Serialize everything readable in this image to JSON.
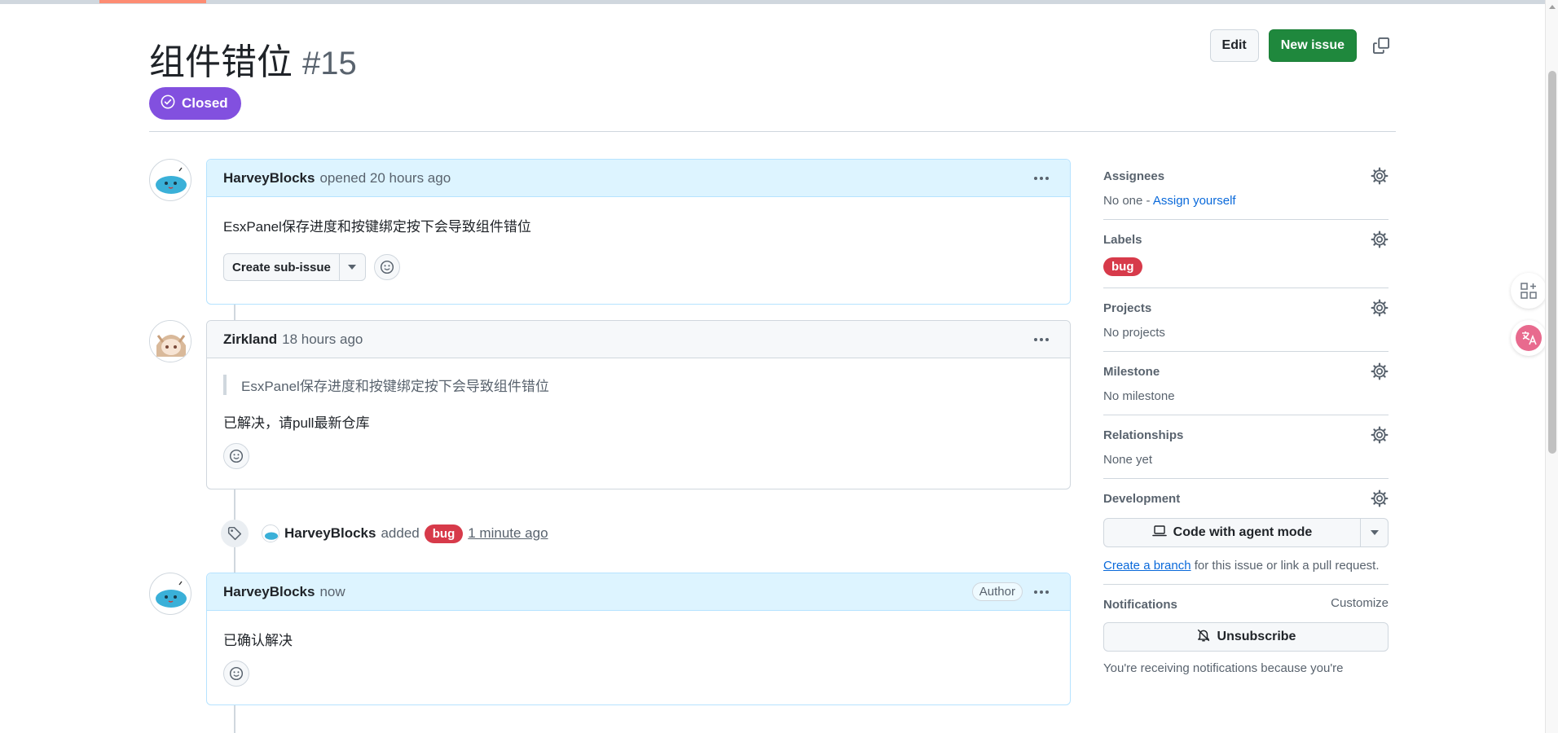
{
  "issue": {
    "title": "组件错位",
    "number": "#15",
    "status": "Closed"
  },
  "header": {
    "edit_label": "Edit",
    "new_issue_label": "New issue",
    "copy_icon": "copy-icon"
  },
  "timeline": {
    "comment1": {
      "user": "HarveyBlocks",
      "meta": "opened 20 hours ago",
      "body": "EsxPanel保存进度和按键绑定按下会导致组件错位",
      "sub_issue_label": "Create sub-issue"
    },
    "comment2": {
      "user": "Zirkland",
      "meta": "18 hours ago",
      "quote": "EsxPanel保存进度和按键绑定按下会导致组件错位",
      "body": "已解决，请pull最新仓库"
    },
    "event": {
      "user": "HarveyBlocks",
      "action": "added",
      "label": "bug",
      "time": "1 minute ago"
    },
    "comment3": {
      "user": "HarveyBlocks",
      "meta": "now",
      "badge": "Author",
      "body": "已确认解决"
    }
  },
  "sidebar": {
    "assignees": {
      "title": "Assignees",
      "value": "No one - ",
      "link": "Assign yourself"
    },
    "labels": {
      "title": "Labels",
      "label": "bug"
    },
    "projects": {
      "title": "Projects",
      "value": "No projects"
    },
    "milestone": {
      "title": "Milestone",
      "value": "No milestone"
    },
    "relationships": {
      "title": "Relationships",
      "value": "None yet"
    },
    "development": {
      "title": "Development",
      "agent_button": "Code with agent mode",
      "branch_link": "Create a branch",
      "branch_rest": " for this issue or link a pull request."
    },
    "notifications": {
      "title": "Notifications",
      "customize": "Customize",
      "unsubscribe": "Unsubscribe",
      "note": "You're receiving notifications because you're"
    }
  },
  "colors": {
    "closed": "#8250df",
    "primary": "#1f883d",
    "bug": "#d73a4a",
    "link": "#0969da"
  }
}
